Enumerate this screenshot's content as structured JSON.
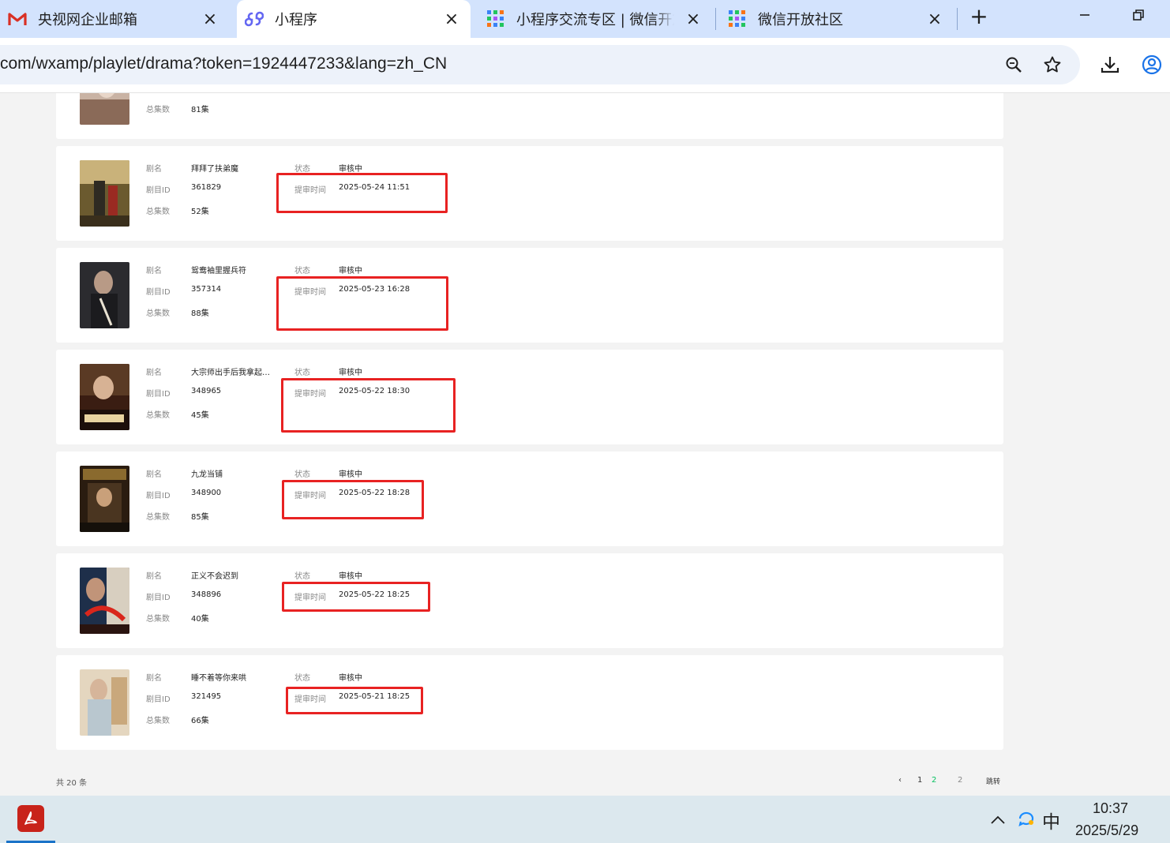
{
  "browser": {
    "tabs": [
      {
        "title": "央视网企业邮箱",
        "icon": "gmail-icon"
      },
      {
        "title": "小程序",
        "icon": "miniprogram-icon",
        "active": true
      },
      {
        "title": "小程序交流专区 | 微信开放",
        "icon": "wechat-open-icon"
      },
      {
        "title": "微信开放社区",
        "icon": "wechat-open-icon"
      }
    ],
    "url": "com/wxamp/playlet/drama?token=1924447233&lang=zh_CN",
    "colors": {
      "tabbar": "#d3e3fd",
      "omnibox": "#edf2fa",
      "highlight": "#e82222",
      "accent": "#07c160"
    }
  },
  "labels": {
    "name": "剧名",
    "id": "剧目ID",
    "episodes": "总集数",
    "status": "状态",
    "submit_time": "提审时间"
  },
  "partial_card": {
    "episodes": "81集"
  },
  "dramas": [
    {
      "name": "拜拜了扶弟魔",
      "id": "361829",
      "episodes": "52集",
      "status": "审核中",
      "submit_time": "2025-05-24  11:51"
    },
    {
      "name": "鸳鸯袖里握兵符",
      "id": "357314",
      "episodes": "88集",
      "status": "审核中",
      "submit_time": "2025-05-23  16:28"
    },
    {
      "name": "大宗师出手后我拿起…",
      "id": "348965",
      "episodes": "45集",
      "status": "审核中",
      "submit_time": "2025-05-22  18:30"
    },
    {
      "name": "九龙当铺",
      "id": "348900",
      "episodes": "85集",
      "status": "审核中",
      "submit_time": "2025-05-22  18:28"
    },
    {
      "name": "正义不会迟到",
      "id": "348896",
      "episodes": "40集",
      "status": "审核中",
      "submit_time": "2025-05-22  18:25"
    },
    {
      "name": "睡不着等你来哄",
      "id": "321495",
      "episodes": "66集",
      "status": "审核中",
      "submit_time": "2025-05-21  18:25"
    }
  ],
  "footer": {
    "total": "共 20 条",
    "pages": [
      "1",
      "2"
    ],
    "current_page": "2",
    "page_input": "2",
    "jump": "跳转"
  },
  "taskbar": {
    "ime": "中",
    "time": "10:37",
    "date": "2025/5/29"
  }
}
